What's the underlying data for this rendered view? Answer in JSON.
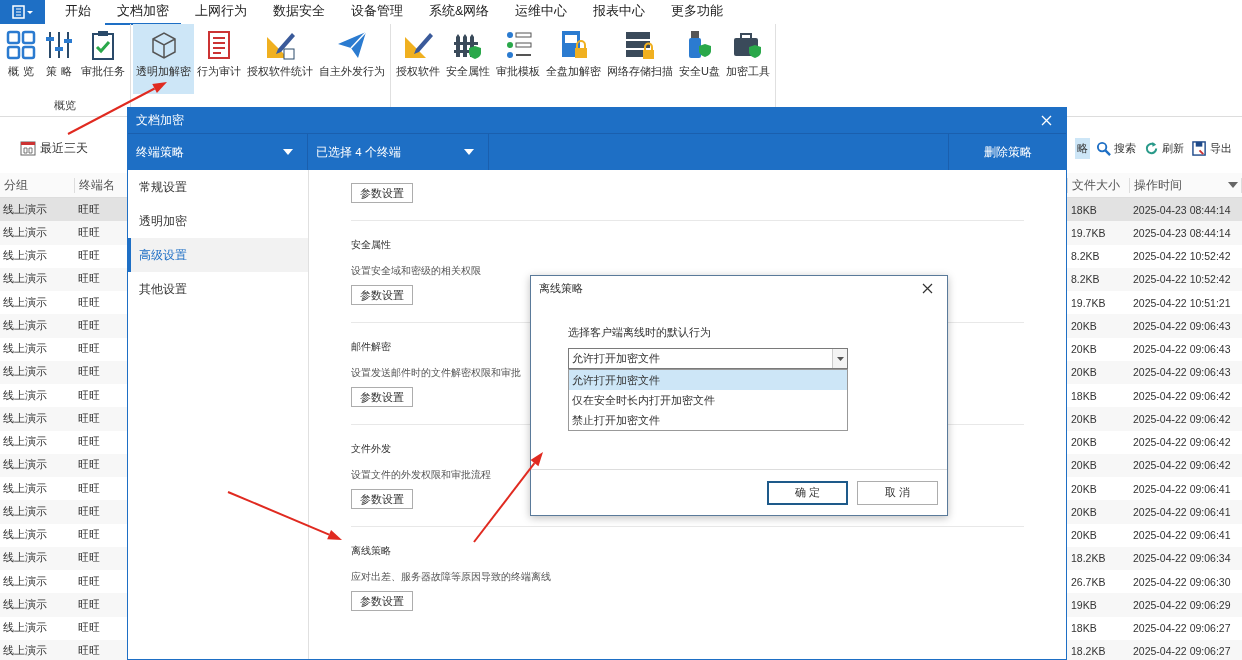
{
  "menu_tabs": [
    {
      "label": "开始",
      "selected": false
    },
    {
      "label": "文档加密",
      "selected": true
    },
    {
      "label": "上网行为",
      "selected": false
    },
    {
      "label": "数据安全",
      "selected": false
    },
    {
      "label": "设备管理",
      "selected": false
    },
    {
      "label": "系统&网络",
      "selected": false
    },
    {
      "label": "运维中心",
      "selected": false
    },
    {
      "label": "报表中心",
      "selected": false
    },
    {
      "label": "更多功能",
      "selected": false
    }
  ],
  "ribbon_groups": [
    {
      "label": "概览",
      "buttons": [
        {
          "label": "概 览",
          "selected": false
        },
        {
          "label": "策 略",
          "selected": false
        },
        {
          "label": "审批任务",
          "selected": false
        }
      ]
    },
    {
      "buttons": [
        {
          "label": "透明加解密",
          "selected": true
        },
        {
          "label": "行为审计",
          "selected": false
        },
        {
          "label": "授权软件统计",
          "selected": false
        },
        {
          "label": "自主外发行为",
          "selected": false
        }
      ]
    },
    {
      "buttons": [
        {
          "label": "授权软件",
          "selected": false
        },
        {
          "label": "安全属性",
          "selected": false
        },
        {
          "label": "审批模板",
          "selected": false
        },
        {
          "label": "全盘加解密",
          "selected": false
        },
        {
          "label": "网络存储扫描",
          "selected": false
        },
        {
          "label": "安全U盘",
          "selected": false
        },
        {
          "label": "加密工具",
          "selected": false
        }
      ]
    }
  ],
  "toolbar": {
    "date_filter": "最近三天",
    "buttons": [
      {
        "label": "略",
        "selected": true
      },
      {
        "label": "搜索",
        "selected": false
      },
      {
        "label": "刷新",
        "selected": false
      },
      {
        "label": "导出",
        "selected": false
      }
    ]
  },
  "table": {
    "columns": [
      "分组",
      "终端名",
      "文件大小",
      "操作时间"
    ],
    "rows": [
      {
        "group": "线上演示",
        "terminal": "旺旺",
        "size": "18KB",
        "time": "2025-04-23 08:44:14",
        "selected": true
      },
      {
        "group": "线上演示",
        "terminal": "旺旺",
        "size": "19.7KB",
        "time": "2025-04-23 08:44:14",
        "selected": false
      },
      {
        "group": "线上演示",
        "terminal": "旺旺",
        "size": "8.2KB",
        "time": "2025-04-22 10:52:42",
        "selected": false
      },
      {
        "group": "线上演示",
        "terminal": "旺旺",
        "size": "8.2KB",
        "time": "2025-04-22 10:52:42",
        "selected": false
      },
      {
        "group": "线上演示",
        "terminal": "旺旺",
        "size": "19.7KB",
        "time": "2025-04-22 10:51:21",
        "selected": false
      },
      {
        "group": "线上演示",
        "terminal": "旺旺",
        "size": "20KB",
        "time": "2025-04-22 09:06:43",
        "selected": false
      },
      {
        "group": "线上演示",
        "terminal": "旺旺",
        "size": "20KB",
        "time": "2025-04-22 09:06:43",
        "selected": false
      },
      {
        "group": "线上演示",
        "terminal": "旺旺",
        "size": "20KB",
        "time": "2025-04-22 09:06:43",
        "selected": false
      },
      {
        "group": "线上演示",
        "terminal": "旺旺",
        "size": "18KB",
        "time": "2025-04-22 09:06:42",
        "selected": false
      },
      {
        "group": "线上演示",
        "terminal": "旺旺",
        "size": "20KB",
        "time": "2025-04-22 09:06:42",
        "selected": false
      },
      {
        "group": "线上演示",
        "terminal": "旺旺",
        "size": "20KB",
        "time": "2025-04-22 09:06:42",
        "selected": false
      },
      {
        "group": "线上演示",
        "terminal": "旺旺",
        "size": "20KB",
        "time": "2025-04-22 09:06:42",
        "selected": false
      },
      {
        "group": "线上演示",
        "terminal": "旺旺",
        "size": "20KB",
        "time": "2025-04-22 09:06:41",
        "selected": false
      },
      {
        "group": "线上演示",
        "terminal": "旺旺",
        "size": "20KB",
        "time": "2025-04-22 09:06:41",
        "selected": false
      },
      {
        "group": "线上演示",
        "terminal": "旺旺",
        "size": "20KB",
        "time": "2025-04-22 09:06:41",
        "selected": false
      },
      {
        "group": "线上演示",
        "terminal": "旺旺",
        "size": "18.2KB",
        "time": "2025-04-22 09:06:34",
        "selected": false
      },
      {
        "group": "线上演示",
        "terminal": "旺旺",
        "size": "26.7KB",
        "time": "2025-04-22 09:06:30",
        "selected": false
      },
      {
        "group": "线上演示",
        "terminal": "旺旺",
        "size": "19KB",
        "time": "2025-04-22 09:06:29",
        "selected": false
      },
      {
        "group": "线上演示",
        "terminal": "旺旺",
        "size": "18KB",
        "time": "2025-04-22 09:06:27",
        "selected": false
      },
      {
        "group": "线上演示",
        "terminal": "旺旺",
        "size": "18.2KB",
        "time": "2025-04-22 09:06:27",
        "selected": false
      }
    ]
  },
  "dialog": {
    "title": "文档加密",
    "policy_dropdown": "终端策略",
    "selection_dropdown": "已选择 4 个终端",
    "delete_button": "删除策略",
    "nav": [
      {
        "label": "常规设置",
        "selected": false
      },
      {
        "label": "透明加密",
        "selected": false
      },
      {
        "label": "高级设置",
        "selected": true
      },
      {
        "label": "其他设置",
        "selected": false
      }
    ],
    "sections": [
      {
        "button": "参数设置"
      },
      {
        "title": "安全属性",
        "description": "设置安全域和密级的相关权限",
        "button": "参数设置"
      },
      {
        "title": "邮件解密",
        "description": "设置发送邮件时的文件解密权限和审批",
        "button": "参数设置"
      },
      {
        "title": "文件外发",
        "description": "设置文件的外发权限和审批流程",
        "button": "参数设置"
      },
      {
        "title": "离线策略",
        "description": "应对出差、服务器故障等原因导致的终端离线",
        "button": "参数设置"
      }
    ]
  },
  "offline_dialog": {
    "title": "离线策略",
    "prompt": "选择客户端离线时的默认行为",
    "select": {
      "value": "允许打开加密文件",
      "expanded": true,
      "options": [
        {
          "label": "允许打开加密文件",
          "selected": true
        },
        {
          "label": "仅在安全时长内打开加密文件",
          "selected": false
        },
        {
          "label": "禁止打开加密文件",
          "selected": false
        }
      ]
    },
    "buttons": [
      {
        "label": "确 定",
        "kind": "primary"
      },
      {
        "label": "取 消",
        "kind": "secondary"
      }
    ]
  }
}
